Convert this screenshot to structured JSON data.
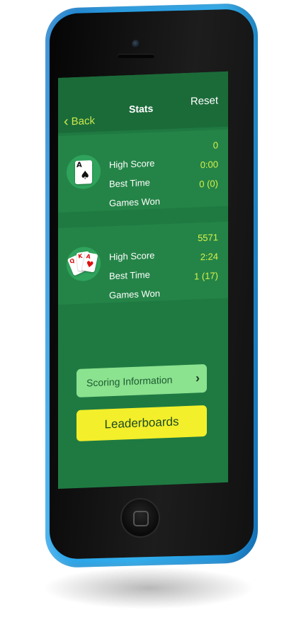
{
  "nav": {
    "back_label": "Back",
    "title": "Stats",
    "reset_label": "Reset"
  },
  "games": [
    {
      "icon": "spade-ace-card-icon",
      "card_rank": "A",
      "card_suit": "♠",
      "stats": [
        {
          "label": "High Score",
          "value": "0"
        },
        {
          "label": "Best Time",
          "value": "0:00"
        },
        {
          "label": "Games Won",
          "value": "0 (0)"
        }
      ]
    },
    {
      "icon": "fanned-cards-icon",
      "card_ranks": [
        "Q",
        "K",
        "A"
      ],
      "card_suit": "♥",
      "stats": [
        {
          "label": "High Score",
          "value": "5571"
        },
        {
          "label": "Best Time",
          "value": "2:24"
        },
        {
          "label": "Games Won",
          "value": "1 (17)"
        }
      ]
    }
  ],
  "buttons": {
    "scoring_label": "Scoring Information",
    "leaderboards_label": "Leaderboards"
  },
  "colors": {
    "phone_body": "#29a6ee",
    "screen_bg": "#1f7a42",
    "accent_text": "#d6f04a",
    "scoring_btn": "#8be28f",
    "leaderboard_btn": "#f3ef2a"
  }
}
